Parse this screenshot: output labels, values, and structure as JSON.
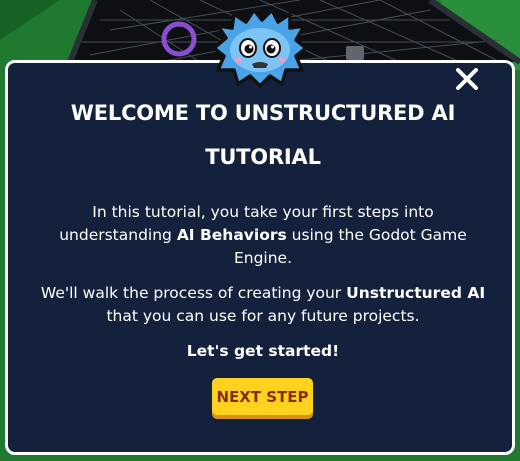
{
  "colors": {
    "modal_background": "#14213d",
    "modal_border": "#ffffff",
    "button_background": "#ffd21f",
    "button_text": "#8a2a08",
    "game_background": "#1a6b2c"
  },
  "mascot": {
    "icon": "blue-robot-mascot-icon"
  },
  "tutorial": {
    "title": "WELCOME TO UNSTRUCTURED AI TUTORIAL",
    "close_icon": "close-icon",
    "paragraph1": {
      "before": "In this tutorial, you take your first steps into understanding ",
      "bold": "AI Behaviors",
      "after": " using the Godot Game Engine."
    },
    "paragraph2": {
      "before": "We'll walk the process of creating your ",
      "bold": "Unstructured AI",
      "after": " that you can use for any future projects."
    },
    "call_to_action": "Let's get started!",
    "next_button_label": "NEXT STEP"
  }
}
